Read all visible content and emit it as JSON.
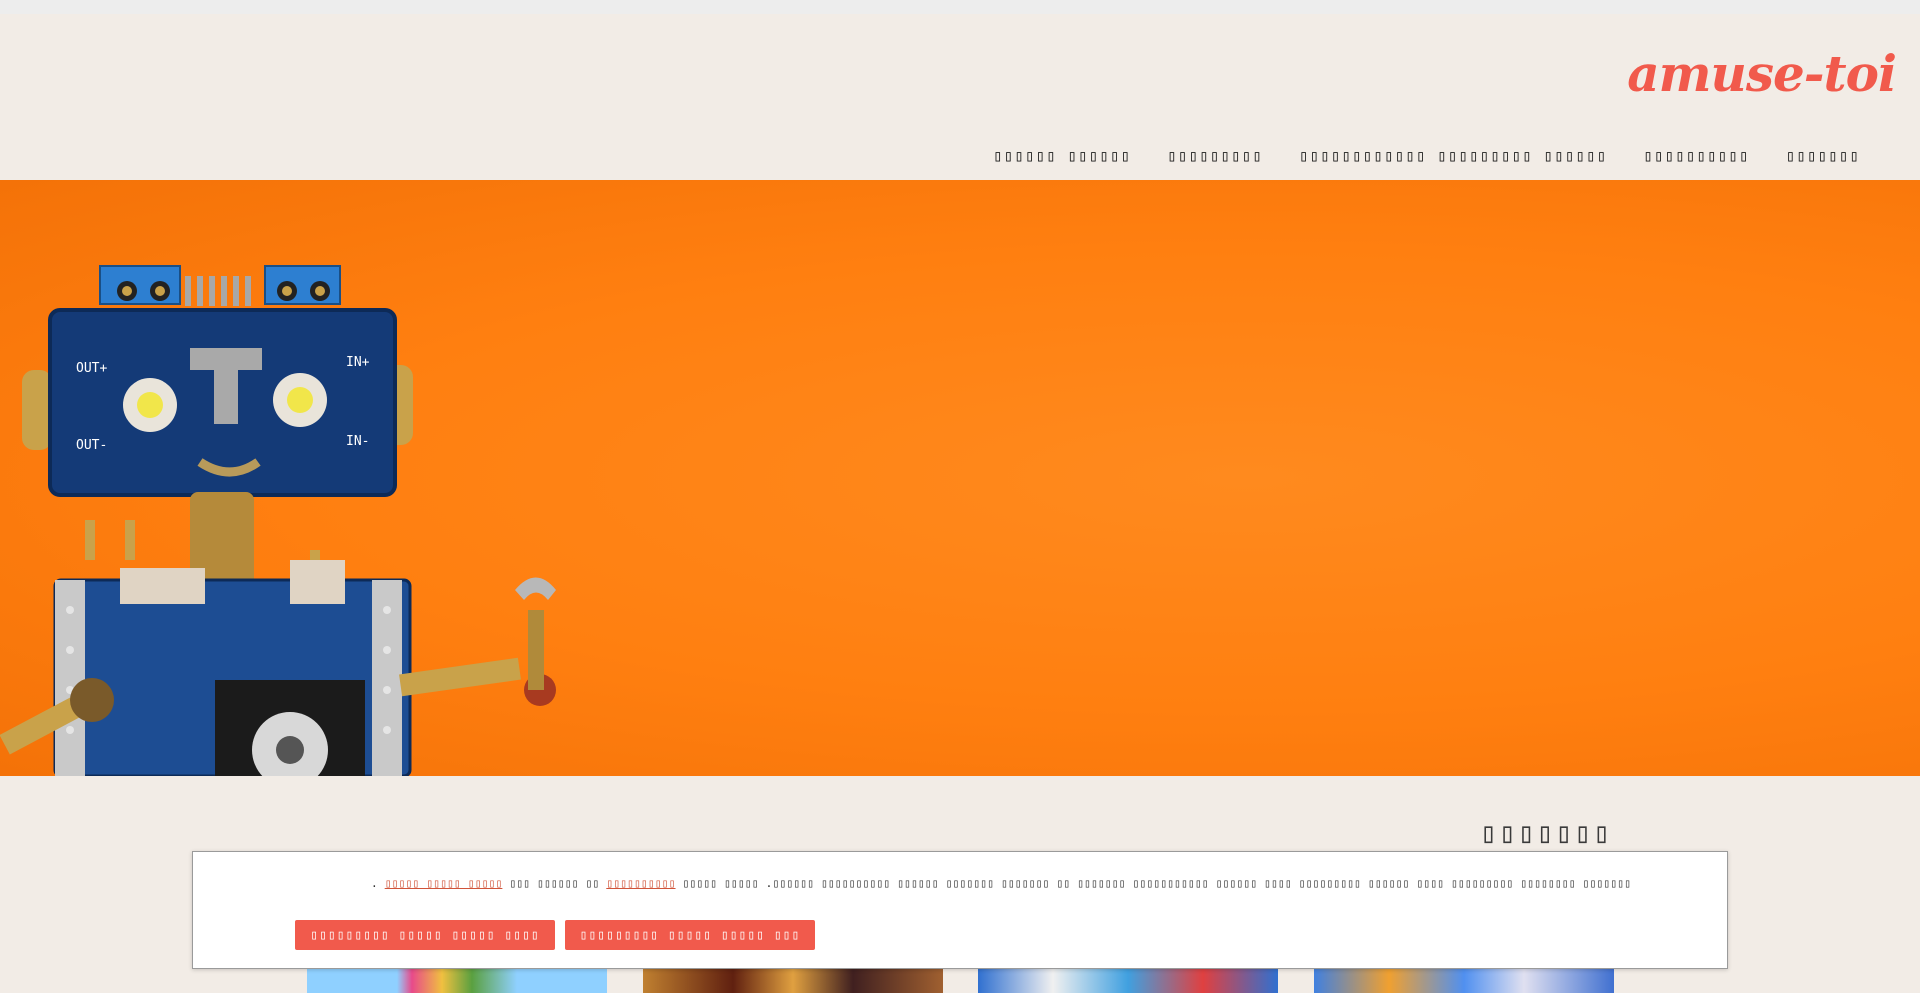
{
  "header": {
    "logo": "amuse-toi",
    "nav": [
      {
        "label": "▯▯▯▯▯▯ ▯▯▯▯▯▯"
      },
      {
        "label": "▯▯▯▯▯▯▯▯▯"
      },
      {
        "label": "▯▯▯▯▯▯▯▯▯▯▯▯ ▯▯▯▯▯▯▯▯▯ ▯▯▯▯▯▯"
      },
      {
        "label": "▯▯▯▯▯▯▯▯▯▯"
      },
      {
        "label": "▯▯▯▯▯▯▯"
      }
    ]
  },
  "section": {
    "title": "▯▯▯▯▯▯▯"
  },
  "cookie_banner": {
    "text_main": "▯▯▯▯▯▯▯ ▯▯▯▯▯▯▯▯ ▯▯▯▯▯▯▯▯▯ ▯▯▯▯ ▯▯▯▯▯▯ ▯▯▯▯▯▯▯▯▯ ▯▯▯▯ ▯▯▯▯▯▯ ▯▯▯▯▯▯▯▯▯▯▯ ▯▯▯▯▯▯▯ ▯▯ ▯▯▯▯▯▯▯ ▯▯▯▯▯▯▯ ▯▯▯▯▯▯ ▯▯▯▯▯▯▯▯▯▯ ▯▯▯▯▯▯. ▯▯▯▯▯ ▯▯▯▯▯",
    "link_1": "▯▯▯▯▯▯▯▯▯▯",
    "text_mid": "▯▯ ▯▯▯▯▯▯ ▯▯▯",
    "link_2": "▯▯▯▯▯ ▯▯▯▯▯ ▯▯▯▯▯",
    "text_end": ".",
    "accept_label": "▯▯▯▯▯▯▯▯▯ ▯▯▯▯▯ ▯▯▯▯▯ ▯▯▯",
    "reject_label": "▯▯▯▯▯▯▯▯▯ ▯▯▯▯▯ ▯▯▯▯▯ ▯▯▯▯"
  },
  "colors": {
    "accent": "#f15a4c",
    "page_background": "#f2ece6",
    "hero_orange": "#ff7f10"
  }
}
